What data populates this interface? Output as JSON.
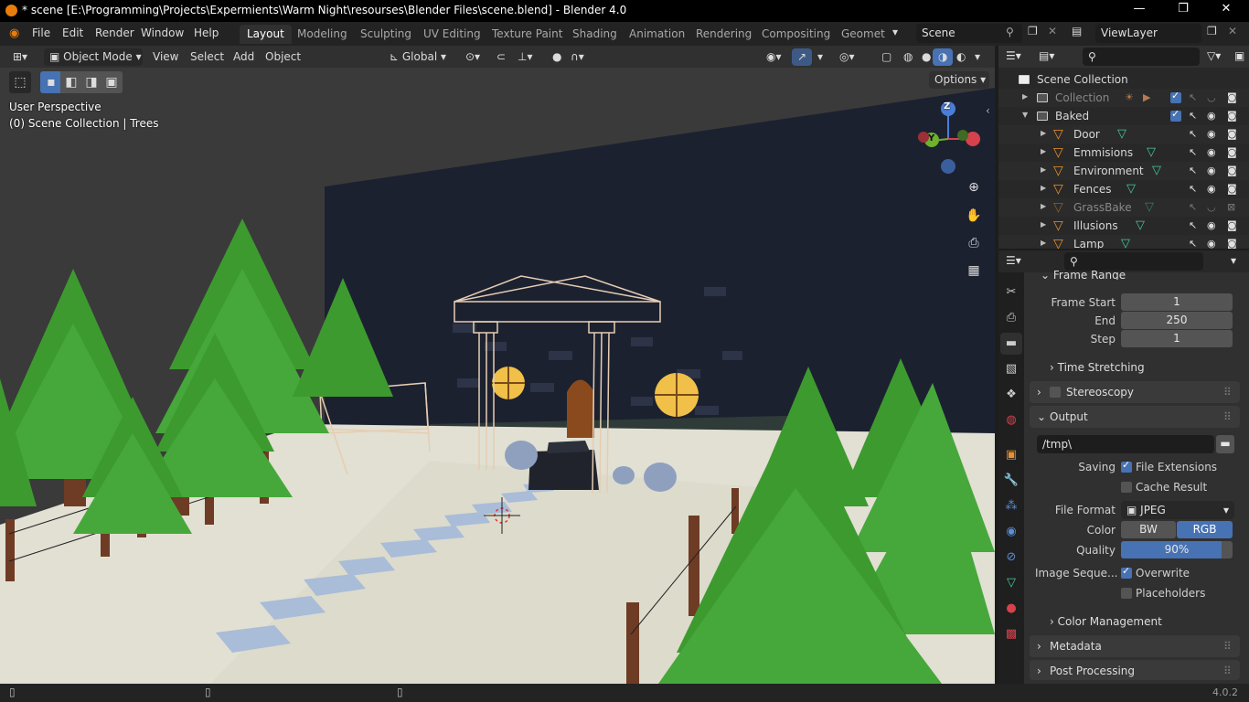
{
  "window": {
    "title": "* scene [E:\\Programming\\Projects\\Expermients\\Warm Night\\resourses\\Blender Files\\scene.blend] - Blender 4.0",
    "minimize": "—",
    "maximize": "❐",
    "close": "✕"
  },
  "menu": [
    "File",
    "Edit",
    "Render",
    "Window",
    "Help"
  ],
  "workspaces": [
    "Layout",
    "Modeling",
    "Sculpting",
    "UV Editing",
    "Texture Paint",
    "Shading",
    "Animation",
    "Rendering",
    "Compositing",
    "Geomet"
  ],
  "active_workspace": "Layout",
  "scene_field": "Scene",
  "viewlayer_field": "ViewLayer",
  "viewport_header": {
    "mode": "Object Mode",
    "menus": [
      "View",
      "Select",
      "Add",
      "Object"
    ],
    "transform": "Global",
    "options": "Options"
  },
  "viewport": {
    "perspective": "User Perspective",
    "collection_info": "(0) Scene Collection | Trees",
    "gizmo": {
      "z": "Z",
      "y": "Y"
    }
  },
  "outliner": {
    "root": "Scene Collection",
    "rows": [
      {
        "label": "Collection",
        "dim": true
      },
      {
        "label": "Baked",
        "dim": false
      },
      {
        "label": "Door",
        "dim": false
      },
      {
        "label": "Emmisions",
        "dim": false
      },
      {
        "label": "Environment",
        "dim": false
      },
      {
        "label": "Fences",
        "dim": false
      },
      {
        "label": "GrassBake",
        "dim": true
      },
      {
        "label": "Illusions",
        "dim": false
      },
      {
        "label": "Lamp",
        "dim": false
      }
    ]
  },
  "properties": {
    "frame_range_title": "Frame Range",
    "frame_start_label": "Frame Start",
    "frame_start": "1",
    "end_label": "End",
    "end": "250",
    "step_label": "Step",
    "step": "1",
    "time_stretching": "Time Stretching",
    "stereoscopy": "Stereoscopy",
    "output_title": "Output",
    "output_path": "/tmp\\",
    "saving_label": "Saving",
    "file_extensions": "File Extensions",
    "cache_result": "Cache Result",
    "file_format_label": "File Format",
    "file_format": "JPEG",
    "color_label": "Color",
    "color_bw": "BW",
    "color_rgb": "RGB",
    "quality_label": "Quality",
    "quality": "90%",
    "quality_fraction": 0.9,
    "image_seq_label": "Image Seque...",
    "overwrite": "Overwrite",
    "placeholders": "Placeholders",
    "color_management": "Color Management",
    "metadata": "Metadata",
    "post_processing": "Post Processing"
  },
  "status": {
    "version": "4.0.2"
  },
  "colors": {
    "accent_blue": "#4772b3",
    "blender_orange": "#e87d0d",
    "mesh_green": "#47c9a0",
    "tree_green": "#3d9a2f"
  }
}
